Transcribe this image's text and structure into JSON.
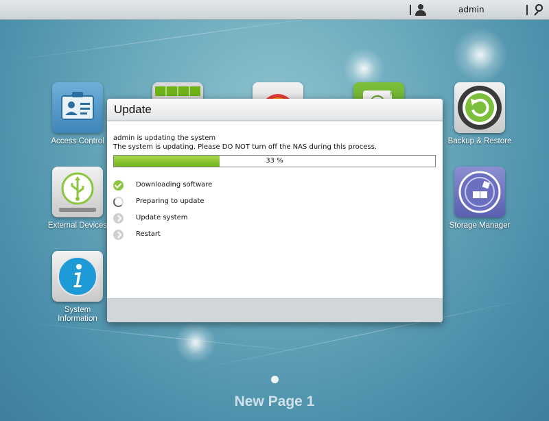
{
  "topbar": {
    "username": "admin"
  },
  "apps": {
    "access_control": "Access Control",
    "external_devices": "External Devices",
    "system_information_line1": "System",
    "system_information_line2": "Information",
    "backup_restore": "Backup & Restore",
    "storage_manager": "Storage Manager"
  },
  "dialog": {
    "title": "Update",
    "message_line1": "admin is updating the system",
    "message_line2": "The system is updating. Please DO NOT turn off the NAS during this process.",
    "progress_percent": 33,
    "progress_label": "33 %",
    "steps": [
      {
        "label": "Downloading software",
        "status": "done",
        "icon": "check-icon"
      },
      {
        "label": "Preparing to update",
        "status": "in-progress",
        "icon": "spinner-icon"
      },
      {
        "label": "Update system",
        "status": "pending",
        "icon": "chevron-right-icon"
      },
      {
        "label": "Restart",
        "status": "pending",
        "icon": "chevron-right-icon"
      }
    ]
  },
  "desktop": {
    "page_name": "New Page 1"
  },
  "colors": {
    "progress_green": "#8cc63f",
    "topbar": "#d7dde0",
    "desktop": "#6aa9bc"
  }
}
